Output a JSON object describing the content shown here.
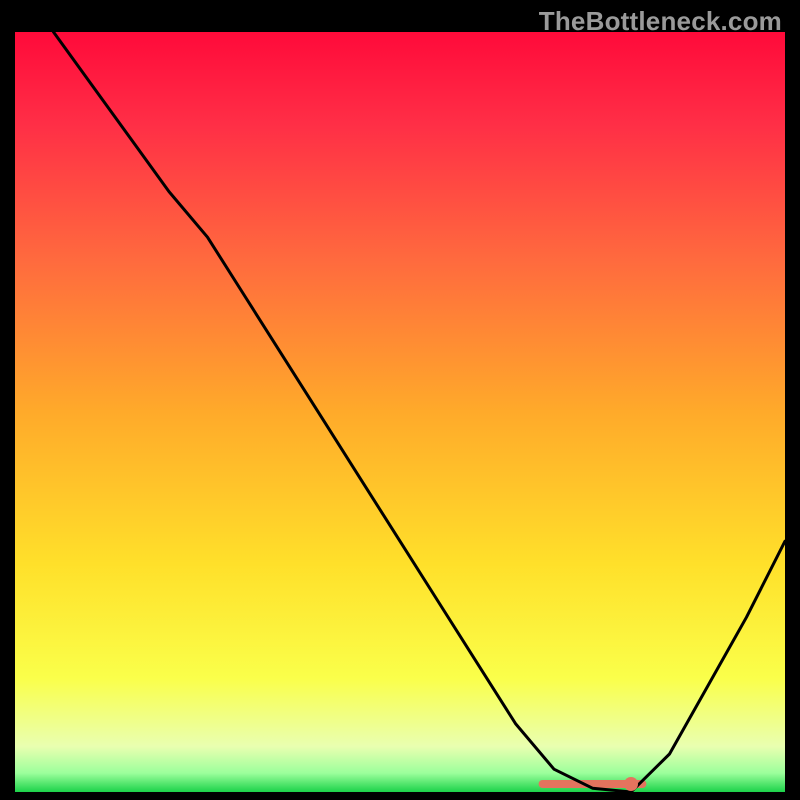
{
  "watermark": "TheBottleneck.com",
  "chart_data": {
    "type": "line",
    "title": "",
    "xlabel": "",
    "ylabel": "",
    "xlim": [
      0,
      100
    ],
    "ylim": [
      0,
      100
    ],
    "grid": false,
    "legend": false,
    "series": [
      {
        "name": "curve",
        "x": [
          5,
          10,
          15,
          20,
          25,
          30,
          35,
          40,
          45,
          50,
          55,
          60,
          65,
          70,
          75,
          80,
          85,
          90,
          95,
          100
        ],
        "y": [
          100,
          93,
          86,
          79,
          73,
          65,
          57,
          49,
          41,
          33,
          25,
          17,
          9,
          3,
          0.5,
          0,
          5,
          14,
          23,
          33
        ]
      }
    ],
    "optimal_marker_x": 80,
    "optimal_band_x": [
      68,
      82
    ],
    "gradient_stops": [
      {
        "pct": 0,
        "color": "#ff0a3a"
      },
      {
        "pct": 12,
        "color": "#ff2e46"
      },
      {
        "pct": 30,
        "color": "#ff6a3e"
      },
      {
        "pct": 50,
        "color": "#ffaa2a"
      },
      {
        "pct": 70,
        "color": "#ffe02a"
      },
      {
        "pct": 85,
        "color": "#faff4a"
      },
      {
        "pct": 94,
        "color": "#e9ffb0"
      },
      {
        "pct": 97.5,
        "color": "#9cff9c"
      },
      {
        "pct": 100,
        "color": "#1cd24a"
      }
    ]
  }
}
